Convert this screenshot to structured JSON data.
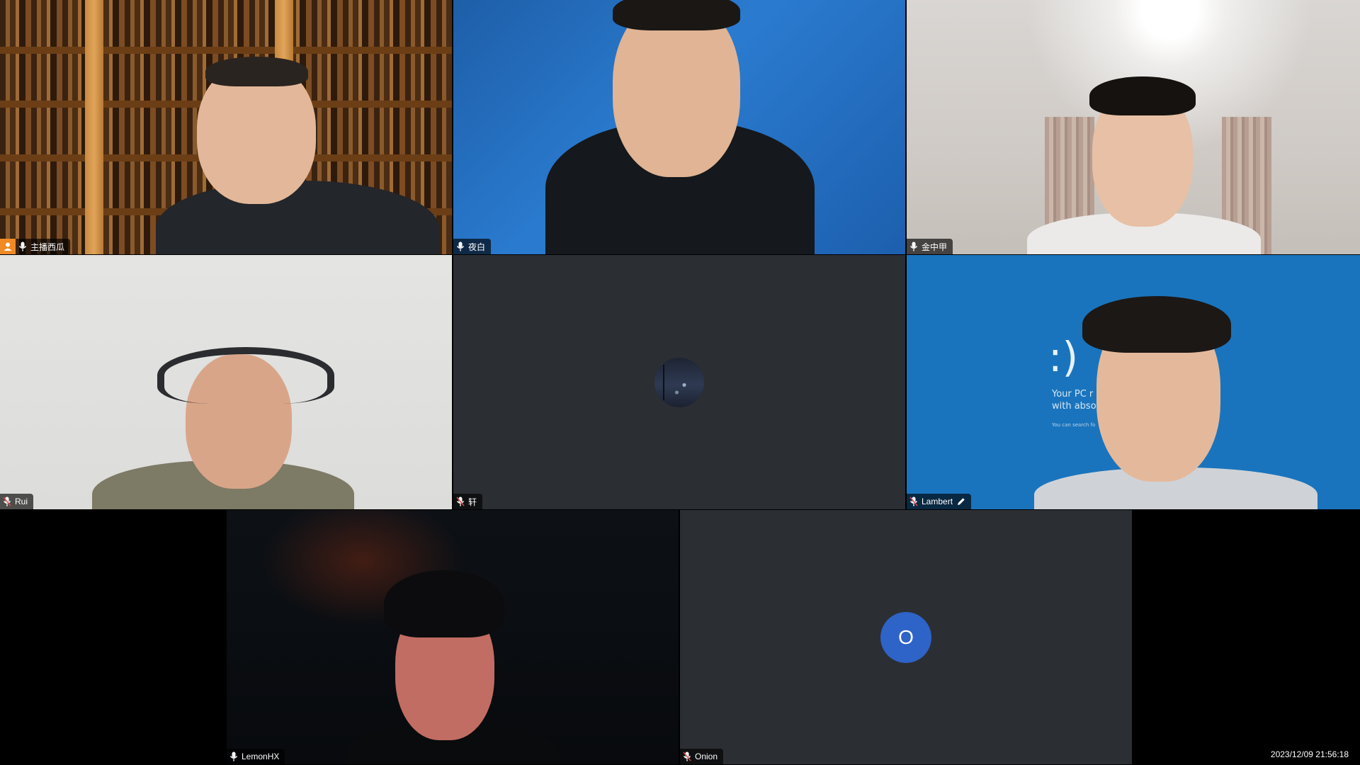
{
  "participants": [
    {
      "name": "主播西瓜",
      "mic": "on",
      "is_host": true
    },
    {
      "name": "夜白",
      "mic": "on",
      "is_host": false
    },
    {
      "name": "金中甲",
      "mic": "on",
      "is_host": false
    },
    {
      "name": "Rui",
      "mic": "muted",
      "is_host": false
    },
    {
      "name": "轩",
      "mic": "muted",
      "is_host": false,
      "camera": "off"
    },
    {
      "name": "Lambert",
      "mic": "muted",
      "is_host": false,
      "editing": true
    },
    {
      "name": "LemonHX",
      "mic": "on",
      "is_host": false,
      "active_speaker": true
    },
    {
      "name": "Onion",
      "mic": "muted",
      "is_host": false,
      "camera": "off",
      "avatar_letter": "O"
    }
  ],
  "wallpaper_text": {
    "face": ":)",
    "line1": "Your PC r",
    "line2": "with abso",
    "small": "You can search fo"
  },
  "timestamp": "2023/12/09 21:56:18",
  "colors": {
    "host_badge": "#f08a24",
    "active_border": "#2e8b57",
    "letter_avatar": "#2e63c7",
    "tile_bg": "#2b2e33"
  }
}
